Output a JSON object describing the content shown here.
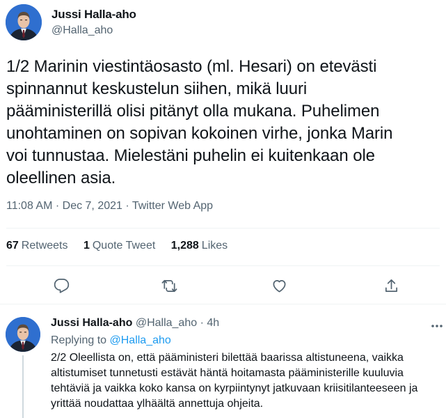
{
  "tweet": {
    "author_name": "Jussi Halla-aho",
    "author_handle": "@Halla_aho",
    "text": "1/2 Marinin viestintäosasto (ml. Hesari) on etevästi\nspinnannut keskustelun siihen, mikä luuri\npääministerillä olisi pitänyt olla mukana. Puhelimen\nunohtaminen on sopivan kokoinen virhe, jonka Marin\nvoi tunnustaa. Mielestäni puhelin ei kuitenkaan ole\noleellinen asia.",
    "meta": "11:08 AM · Dec 7, 2021 · Twitter Web App",
    "stats": {
      "retweets_count": "67",
      "retweets_label": "Retweets",
      "quotes_count": "1",
      "quotes_label": "Quote Tweet",
      "likes_count": "1,288",
      "likes_label": "Likes"
    },
    "actions": [
      "reply-icon",
      "retweet-icon",
      "like-icon",
      "share-icon"
    ]
  },
  "reply": {
    "author_name": "Jussi Halla-aho",
    "author_handle": "@Halla_aho",
    "separator": "·",
    "time": "4h",
    "replying_prefix": "Replying to",
    "replying_to": "@Halla_aho",
    "text": "2/2 Oleellista on, että pääministeri bilettää baarissa altistuneena, vaikka\naltistumiset tunnetusti estävät häntä hoitamasta pääministerille kuuluvia\ntehtäviä ja vaikka koko kansa on kyrpiintynyt jatkuvaan kriisitilanteeseen ja\nyrittää noudattaa ylhäältä annettuja ohjeita."
  },
  "colors": {
    "text": "#0f1419",
    "secondary": "#536471",
    "link": "#1d9bf0",
    "divider": "#eff3f4"
  }
}
